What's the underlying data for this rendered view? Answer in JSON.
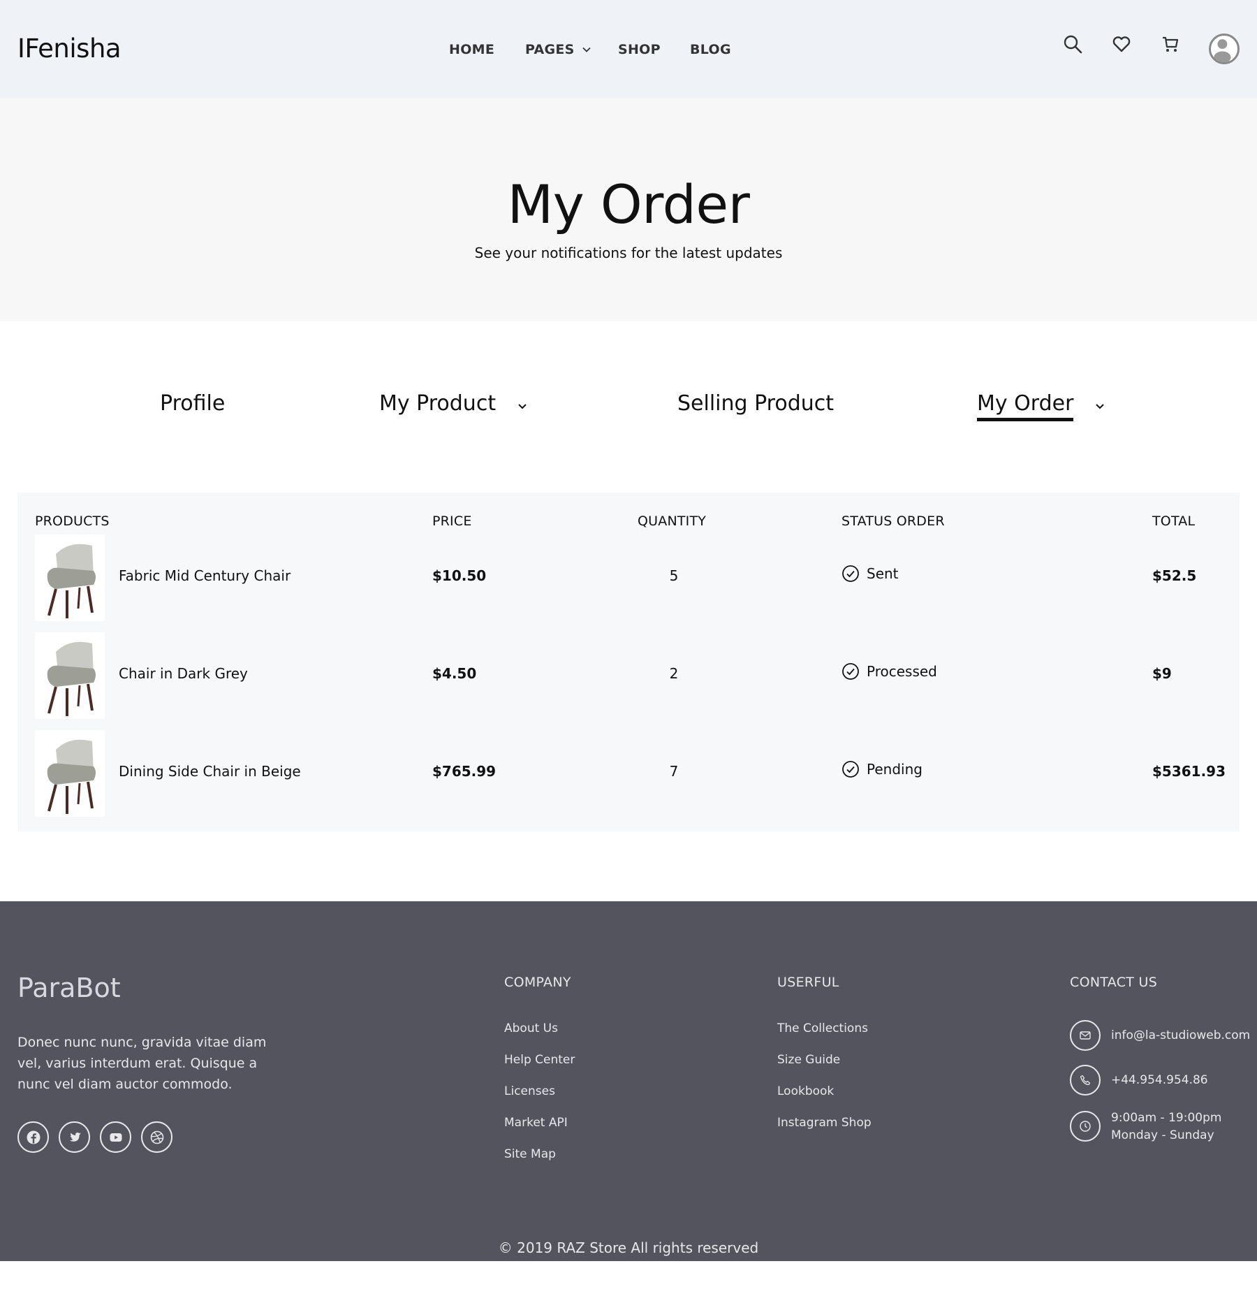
{
  "header": {
    "logo": "IFenisha",
    "nav": {
      "home": "HOME",
      "pages": "PAGES",
      "shop": "SHOP",
      "blog": "BLOG"
    }
  },
  "hero": {
    "title": "My Order",
    "subtitle": "See your notifications for the latest updates"
  },
  "tabs": {
    "profile": "Profile",
    "my_product": "My Product",
    "selling_product": "Selling Product",
    "my_order": "My Order",
    "active": "My Order"
  },
  "table": {
    "headers": {
      "products": "PRODUCTS",
      "price": "PRICE",
      "quantity": "QUANTITY",
      "status": "STATUS ORDER",
      "total": "TOTAL"
    },
    "rows": [
      {
        "name": "Fabric Mid Century Chair",
        "price": "$10.50",
        "quantity": "5",
        "status": "Sent",
        "total": "$52.5"
      },
      {
        "name": "Chair in Dark Grey",
        "price": "$4.50",
        "quantity": "2",
        "status": "Processed",
        "total": "$9"
      },
      {
        "name": "Dining Side Chair in Beige",
        "price": "$765.99",
        "quantity": "7",
        "status": "Pending",
        "total": "$5361.93"
      }
    ]
  },
  "footer": {
    "brand": "ParaBot",
    "description": "Donec nunc nunc, gravida vitae diam vel, varius interdum erat. Quisque a nunc vel diam auctor commodo.",
    "social_icons": [
      "facebook-icon",
      "twitter-icon",
      "youtube-icon",
      "dribbble-icon"
    ],
    "company": {
      "title": "COMPANY",
      "links": [
        "About Us",
        "Help Center",
        "Licenses",
        "Market API",
        "Site Map"
      ]
    },
    "userful": {
      "title": "USERFUL",
      "links": [
        "The Collections",
        "Size Guide",
        "Lookbook",
        "Instagram Shop"
      ]
    },
    "contact": {
      "title": "CONTACT US",
      "email": "info@la-studioweb.com",
      "phone": "+44.954.954.86",
      "hours": "9:00am - 19:00pm",
      "days": "Monday - Sunday"
    },
    "copyright": "© 2019 RAZ Store All rights reserved"
  },
  "colors": {
    "header_bg": "#eff2f7",
    "hero_bg": "#f7f7f7",
    "table_bg": "#f6f8fa",
    "footer_bg": "#53545d",
    "text": "#111111"
  }
}
